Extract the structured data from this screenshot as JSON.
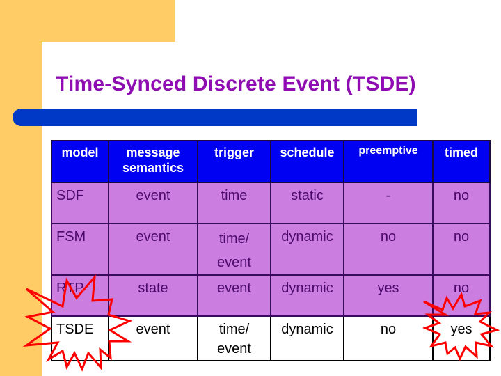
{
  "slide": {
    "title": "Time-Synced Discrete Event (TSDE)",
    "colors": {
      "accent_band": "#ffcc66",
      "title_text": "#8f0cb3",
      "title_bar": "#0039c6",
      "header_fill": "#0000f2",
      "row_fill": "#cc7ee0",
      "row_text": "#4b0a6b",
      "highlight_stroke": "#ff0000"
    }
  },
  "table": {
    "headers": [
      "model",
      "message semantics",
      "trigger",
      "schedule",
      "preemptive",
      "timed"
    ],
    "header_lines": {
      "message_1": "message",
      "message_2": "semantics"
    },
    "rows": [
      {
        "model": "SDF",
        "message": "event",
        "trigger_1": "time",
        "trigger_2": "",
        "schedule": "static",
        "preemptive": "-",
        "timed": "no"
      },
      {
        "model": "FSM",
        "message": "event",
        "trigger_1": "time/",
        "trigger_2": "event",
        "schedule": "dynamic",
        "preemptive": "no",
        "timed": "no"
      },
      {
        "model": "RTP",
        "message": "state",
        "trigger_1": "event",
        "trigger_2": "",
        "schedule": "dynamic",
        "preemptive": "yes",
        "timed": "no"
      },
      {
        "model": "TSDE",
        "message": "event",
        "trigger_1": "time/",
        "trigger_2": "event",
        "schedule": "dynamic",
        "preemptive": "no",
        "timed": "yes"
      }
    ],
    "highlighted_cells": [
      "TSDE model",
      "TSDE timed (yes)"
    ]
  }
}
